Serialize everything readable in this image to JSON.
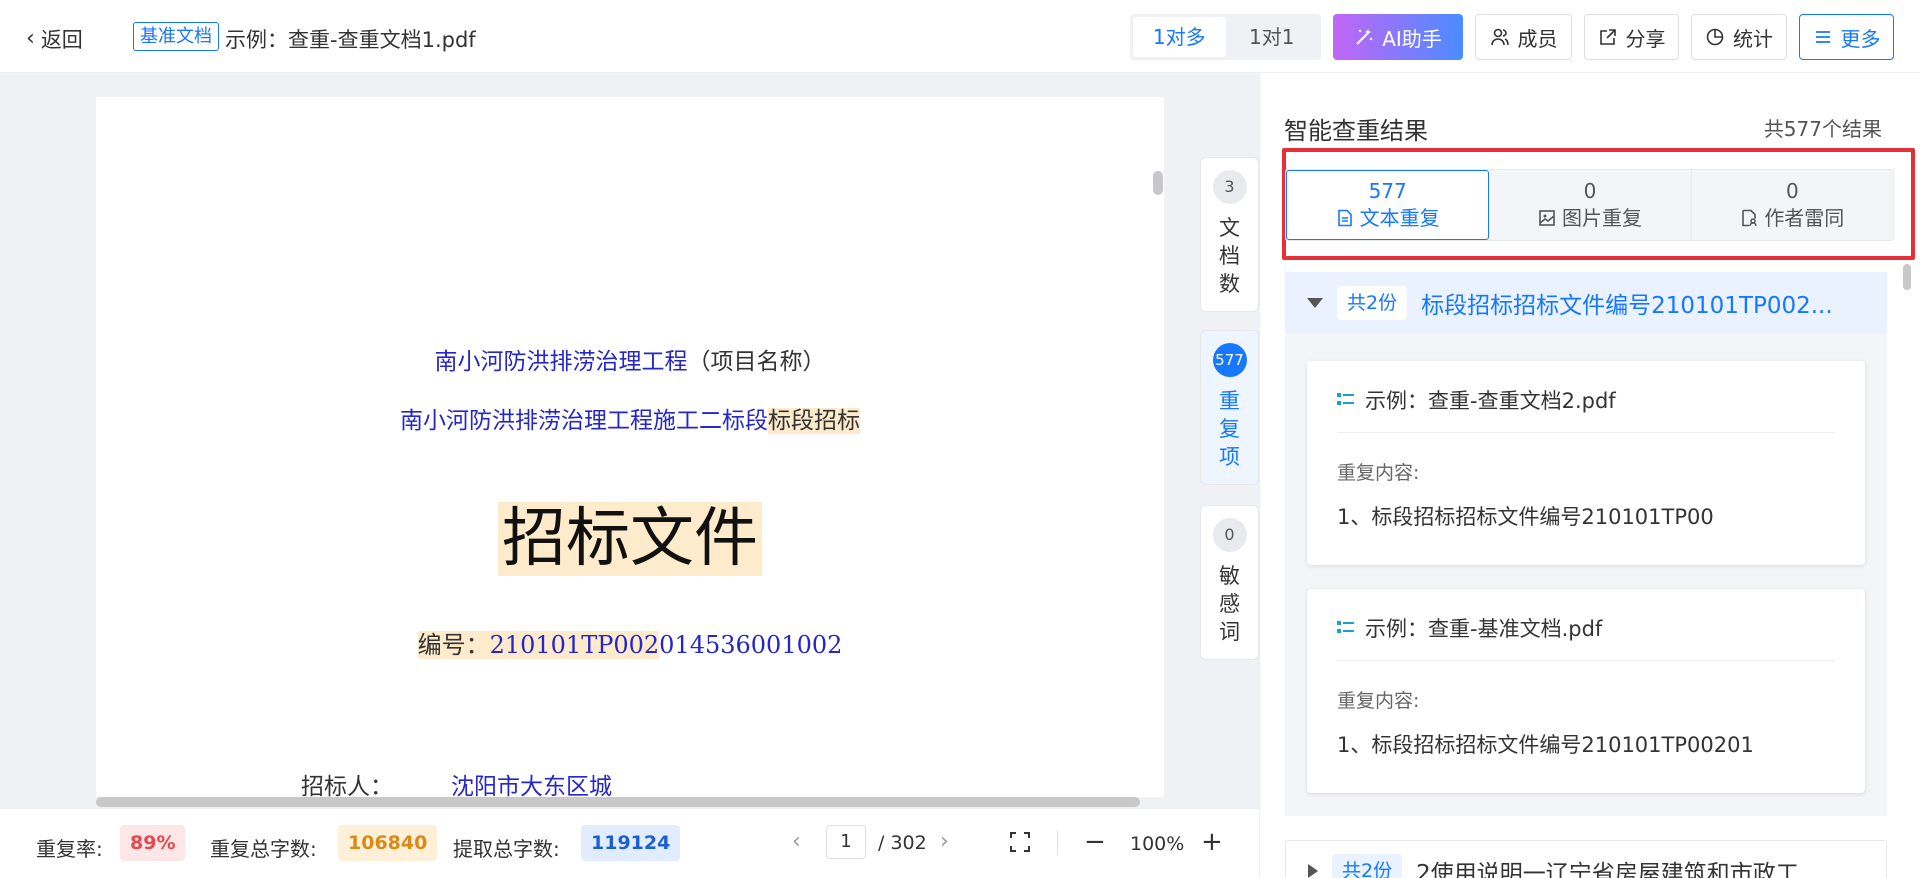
{
  "header": {
    "back_label": "返回",
    "base_tag": "基准文档",
    "doc_title": "示例：查重-查重文档1.pdf",
    "mode_tabs": [
      {
        "label": "1对多",
        "active": true
      },
      {
        "label": "1对1",
        "active": false
      }
    ],
    "ai_label": "AI助手",
    "members_label": "成员",
    "share_label": "分享",
    "stats_label": "统计",
    "more_label": "更多"
  },
  "document": {
    "project_name": "南小河防洪排涝治理工程",
    "project_name_suffix": "（项目名称）",
    "section_prefix": "南小河防洪排涝治理工程施工二标段",
    "section_highlight": "标段招标",
    "big_title": "招标文件",
    "code_label": "编号：",
    "code_highlight": "210101TP002",
    "code_rest": "014536001002",
    "tenderer_label": "招标人：",
    "tenderer_value": "沈阳市大东区城"
  },
  "side_tabs": [
    {
      "count": "3",
      "label": "文档数",
      "active": false
    },
    {
      "count": "577",
      "label": "重复项",
      "active": true
    },
    {
      "count": "0",
      "label": "敏感词",
      "active": false
    }
  ],
  "status": {
    "dup_rate_label": "重复率:",
    "dup_rate_value": "89%",
    "dup_words_label": "重复总字数:",
    "dup_words_value": "106840",
    "extract_words_label": "提取总字数:",
    "extract_words_value": "119124",
    "page_current": "1",
    "page_total": "/ 302",
    "zoom": "100%"
  },
  "results": {
    "title": "智能查重结果",
    "total": "共577个结果",
    "tabs": [
      {
        "count": "577",
        "label": "文本重复",
        "icon": "document-icon",
        "active": true
      },
      {
        "count": "0",
        "label": "图片重复",
        "icon": "image-icon",
        "active": false
      },
      {
        "count": "0",
        "label": "作者雷同",
        "icon": "author-file-icon",
        "active": false
      }
    ],
    "groups": [
      {
        "count_label": "共2份",
        "title": "标段招标招标文件编号210101TP002...",
        "expanded": true,
        "cards": [
          {
            "file": "示例：查重-查重文档2.pdf",
            "content_label": "重复内容:",
            "content": "1、标段招标招标文件编号210101TP00"
          },
          {
            "file": "示例：查重-基准文档.pdf",
            "content_label": "重复内容:",
            "content": "1、标段招标招标文件编号210101TP00201"
          }
        ]
      },
      {
        "count_label": "共2份",
        "title": "2使用说明一辽宁省房屋建筑和市政工",
        "expanded": false
      }
    ]
  },
  "colors": {
    "accent": "#1677ff",
    "highlight": "#fdebcb",
    "annotation_box": "#e5303a"
  }
}
